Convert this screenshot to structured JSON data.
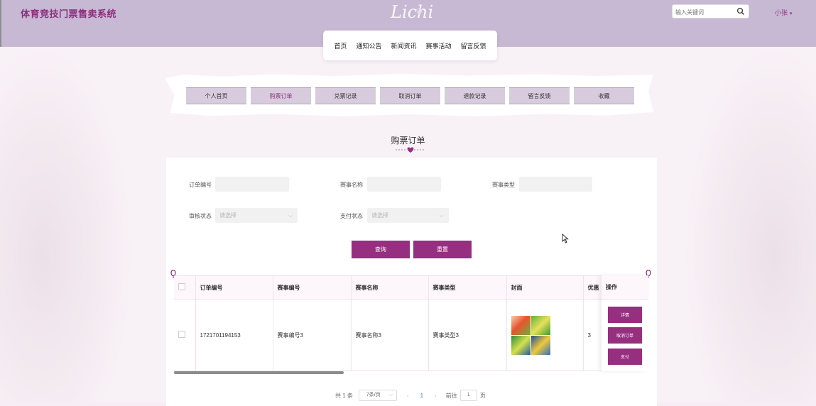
{
  "header": {
    "site_title": "体育竞技门票售卖系统",
    "logo_text": "Lichi",
    "search_placeholder": "输入关键词",
    "user_name": "小张"
  },
  "top_nav": [
    "首页",
    "通知公告",
    "新闻资讯",
    "赛事活动",
    "留言反馈"
  ],
  "sub_nav": {
    "tabs": [
      "个人首页",
      "购票订单",
      "兑票记录",
      "取消订单",
      "退款记录",
      "留言反馈",
      "收藏"
    ],
    "active_index": 1
  },
  "section_title": "购票订单",
  "filters": {
    "order_no_label": "订单编号",
    "match_name_label": "赛事名称",
    "match_type_label": "赛事类型",
    "review_status_label": "审核状态",
    "review_status_placeholder": "请选择",
    "pay_status_label": "支付状态",
    "pay_status_placeholder": "请选择",
    "query_button": "查询",
    "reset_button": "重置"
  },
  "table": {
    "columns": [
      "订单编号",
      "赛事编号",
      "赛事名称",
      "赛事类型",
      "封面",
      "优惠"
    ],
    "op_column": "操作",
    "rows": [
      {
        "order_no": "1721701194153",
        "match_no": "赛事编号3",
        "match_name": "赛事名称3",
        "match_type": "赛事类型3",
        "discount": "3"
      }
    ],
    "row_actions": [
      "详情",
      "取消订单",
      "支付"
    ]
  },
  "pagination": {
    "total_text": "共 1 条",
    "page_size": "7条/页",
    "prev": "‹",
    "current_page": "1",
    "next": "›",
    "goto_prefix": "前往",
    "goto_value": "1",
    "goto_suffix": "页"
  },
  "colors": {
    "header_bg": "#c7b8d3",
    "brand": "#8b2f7c",
    "button": "#962f7f",
    "page_bg": "#f8f1f6"
  },
  "icons": {
    "search": "search-icon",
    "caret": "chevron-down-icon",
    "pin": "balloon-pin-icon"
  }
}
